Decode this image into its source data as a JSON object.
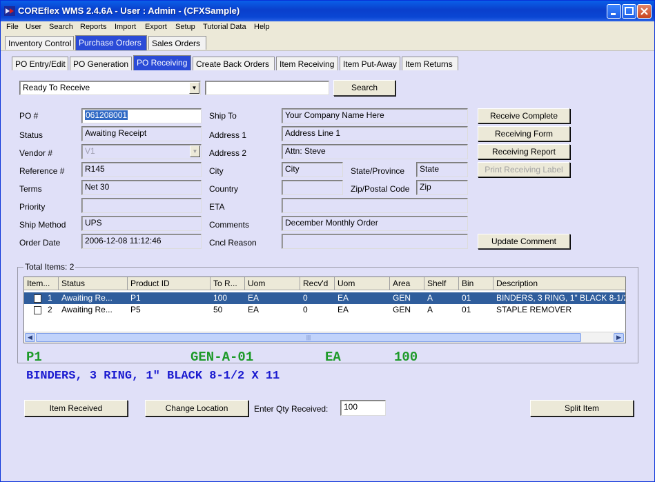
{
  "window": {
    "title": "COREflex WMS 2.4.6A - User : Admin - (CFXSample)",
    "icon": "app-flag-icon"
  },
  "menu": [
    "File",
    "User",
    "Search",
    "Reports",
    "Import",
    "Export",
    "Setup",
    "Tutorial Data",
    "Help"
  ],
  "main_tabs": [
    "Inventory Control",
    "Purchase Orders",
    "Sales Orders"
  ],
  "main_tabs_active": "Purchase Orders",
  "sub_tabs": [
    "PO Entry/Edit",
    "PO Generation",
    "PO Receiving",
    "Create Back Orders",
    "Item Receiving",
    "Item Put-Away",
    "Item Returns"
  ],
  "sub_tabs_active": "PO Receiving",
  "search": {
    "filter_value": "Ready To Receive",
    "text_value": "",
    "button_label": "Search"
  },
  "po": {
    "labels": {
      "po_num": "PO #",
      "status": "Status",
      "vendor": "Vendor #",
      "reference": "Reference #",
      "terms": "Terms",
      "priority": "Priority",
      "ship_method": "Ship Method",
      "order_date": "Order Date",
      "ship_to": "Ship To",
      "address1": "Address 1",
      "address2": "Address 2",
      "city": "City",
      "country": "Country",
      "eta": "ETA",
      "comments": "Comments",
      "cncl_reason": "Cncl Reason",
      "state": "State/Province",
      "zip": "Zip/Postal Code"
    },
    "values": {
      "po_num": "061208001",
      "status": "Awaiting Receipt",
      "vendor": "V1",
      "reference": "R145",
      "terms": "Net 30",
      "priority": "",
      "ship_method": "UPS",
      "order_date": "2006-12-08 11:12:46",
      "ship_to": "Your Company Name Here",
      "address1": "Address Line 1",
      "address2": "Attn: Steve",
      "city": "City",
      "country": "",
      "eta": "",
      "comments": "December Monthly Order",
      "cncl_reason": "",
      "state": "State",
      "zip": "Zip"
    }
  },
  "actions": {
    "receive_complete": "Receive Complete",
    "receiving_form": "Receiving Form",
    "receiving_report": "Receiving Report",
    "print_receiving_label": "Print Receiving Label",
    "update_comment": "Update Comment"
  },
  "items": {
    "total_label": "Total Items: 2",
    "columns": [
      "Item...",
      "Status",
      "Product ID",
      "To R...",
      "Uom",
      "Recv'd",
      "Uom",
      "Area",
      "Shelf",
      "Bin",
      "Description"
    ],
    "rows": [
      {
        "item": "1",
        "status": "Awaiting Re...",
        "product": "P1",
        "to_r": "100",
        "uom": "EA",
        "recvd": "0",
        "uom2": "EA",
        "area": "GEN",
        "shelf": "A",
        "bin": "01",
        "desc": "BINDERS, 3 RING, 1\" BLACK 8-1/2"
      },
      {
        "item": "2",
        "status": "Awaiting Re...",
        "product": "P5",
        "to_r": "50",
        "uom": "EA",
        "recvd": "0",
        "uom2": "EA",
        "area": "GEN",
        "shelf": "A",
        "bin": "01",
        "desc": "STAPLE REMOVER"
      }
    ]
  },
  "selected_item": {
    "product": "P1",
    "location": "GEN-A-01",
    "uom": "EA",
    "qty": "100",
    "description": "BINDERS, 3 RING, 1\" BLACK 8-1/2 X 11"
  },
  "receive": {
    "item_received_label": "Item Received",
    "change_location_label": "Change Location",
    "qty_label": "Enter Qty Received:",
    "qty_value": "100",
    "split_label": "Split Item"
  },
  "colors": {
    "accent": "#2a4bd7",
    "green_text": "#1e9a2a",
    "blue_text": "#1a1ad0",
    "selection": "#2f5d9c"
  }
}
